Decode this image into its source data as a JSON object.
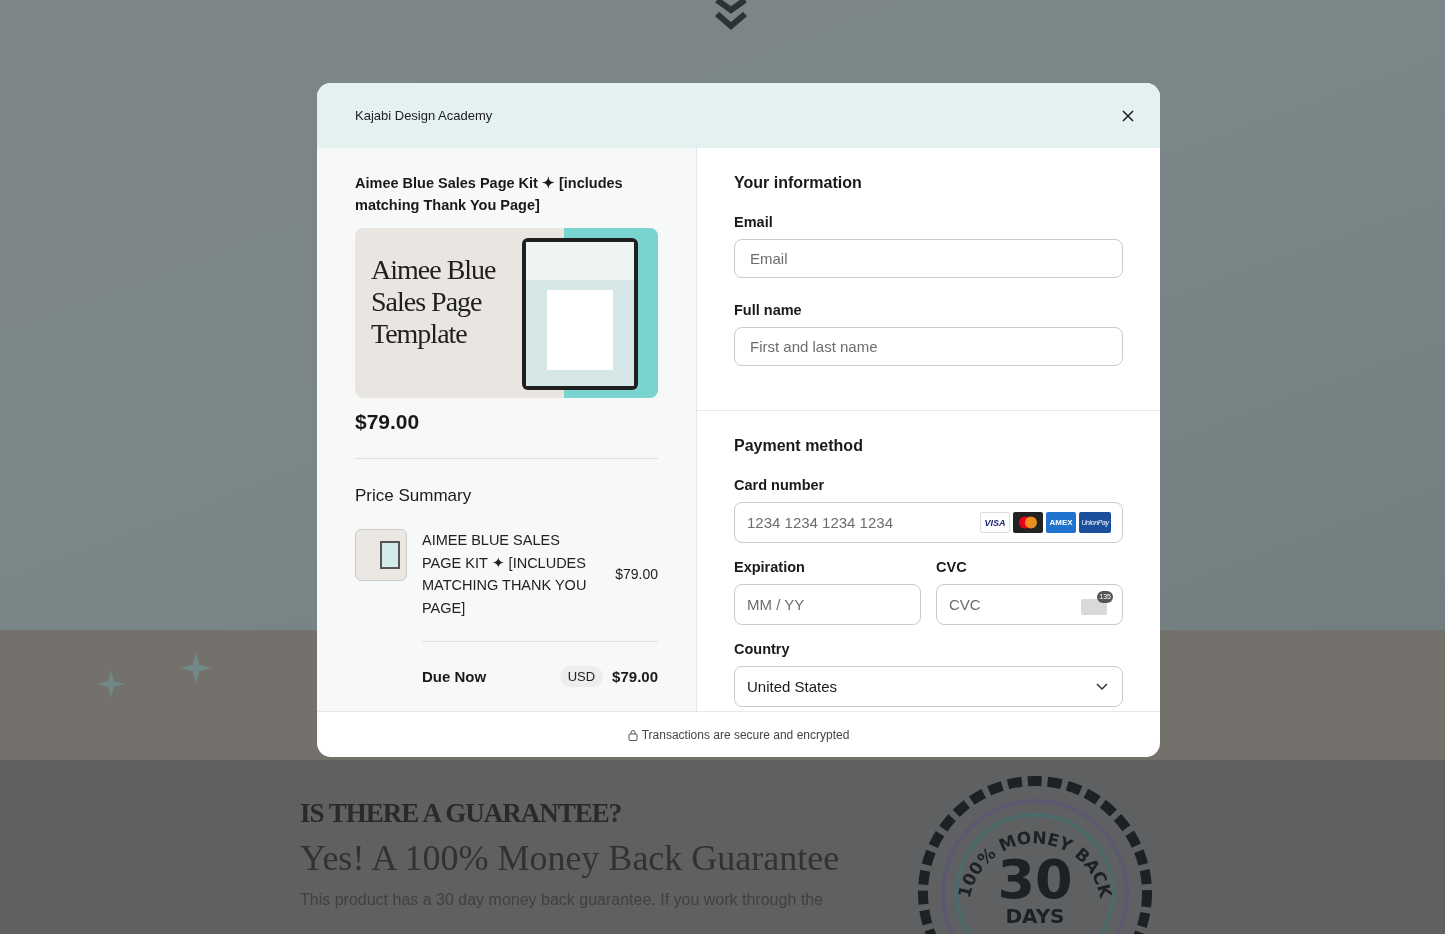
{
  "background": {
    "heading": "IS THERE A GUARANTEE?",
    "subheading": "Yes! A 100% Money Back Guarantee",
    "paragraph": "This product has a 30 day money back guarantee. If you work through the",
    "badge": {
      "arc_text": "100% MONEY BACK",
      "number": "30",
      "unit": "DAYS"
    }
  },
  "modal": {
    "title": "Kajabi Design Academy"
  },
  "product": {
    "title": "Aimee Blue Sales Page Kit ✦ [includes matching Thank You Page]",
    "image_text": "Aimee Blue Sales Page Template",
    "price": "$79.00"
  },
  "price_summary": {
    "title": "Price Summary",
    "items": [
      {
        "name": "AIMEE BLUE SALES PAGE KIT ✦  [INCLUDES MATCHING THANK YOU PAGE]",
        "price": "$79.00"
      }
    ],
    "due": {
      "label": "Due Now",
      "currency": "USD",
      "amount": "$79.00"
    }
  },
  "your_information": {
    "title": "Your information",
    "fields": [
      {
        "label": "Email",
        "placeholder": "Email"
      },
      {
        "label": "Full name",
        "placeholder": "First and last name"
      }
    ]
  },
  "payment": {
    "title": "Payment method",
    "card_number": {
      "label": "Card number",
      "placeholder": "1234 1234 1234 1234"
    },
    "card_brands": [
      {
        "kind": "visa",
        "label": "VISA"
      },
      {
        "kind": "mastercard"
      },
      {
        "kind": "amex",
        "label": "AMEX"
      },
      {
        "kind": "unionpay",
        "label": "UnionPay"
      }
    ],
    "expiration": {
      "label": "Expiration",
      "placeholder": "MM / YY"
    },
    "cvc": {
      "label": "CVC",
      "placeholder": "CVC",
      "icon_text": "135"
    },
    "country": {
      "label": "Country",
      "value": "United States"
    }
  },
  "footer": {
    "text": "Transactions are secure and encrypted"
  }
}
